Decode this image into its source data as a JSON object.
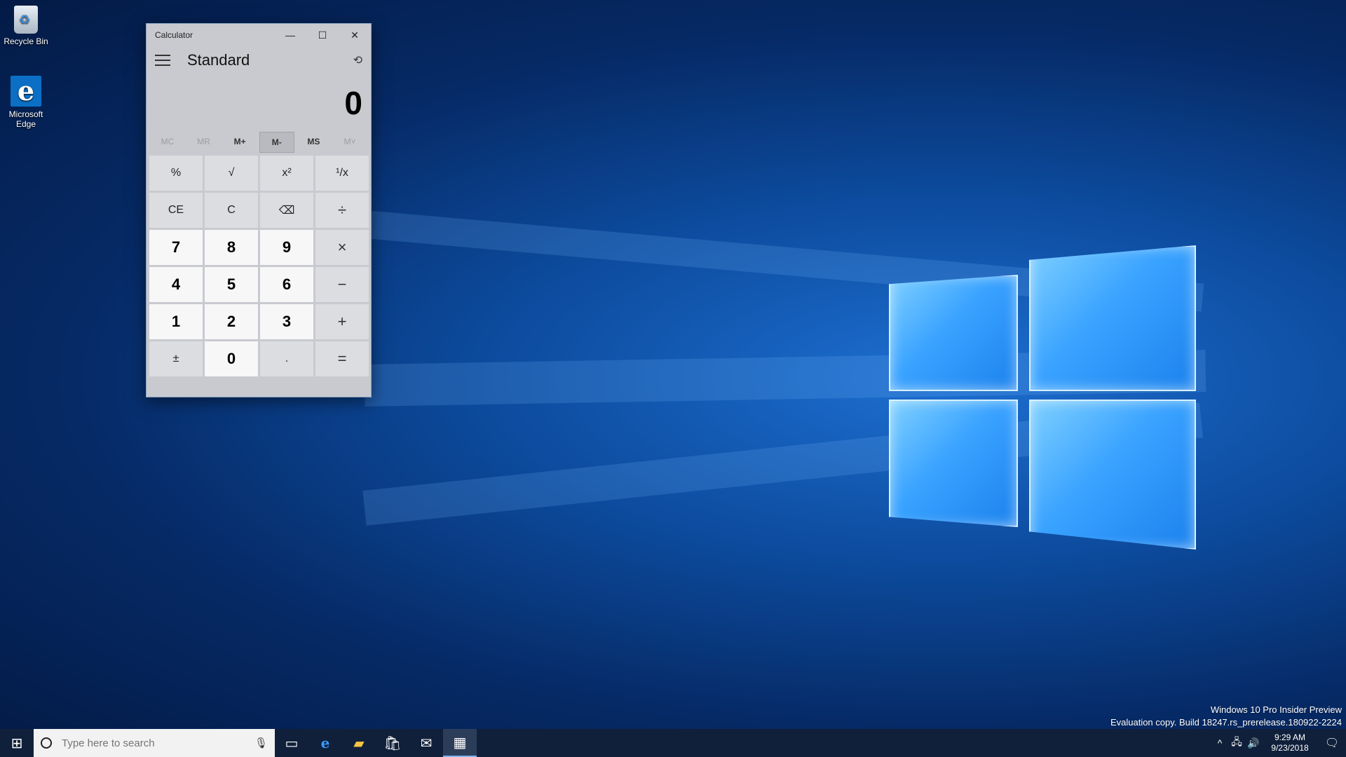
{
  "desktop": {
    "icons": [
      {
        "label": "Recycle Bin",
        "icon": "recycle-bin-icon"
      },
      {
        "label": "Microsoft\nEdge",
        "icon": "edge-icon"
      }
    ],
    "watermark_line1": "Windows 10 Pro Insider Preview",
    "watermark_line2": "Evaluation copy. Build 18247.rs_prerelease.180922-2224"
  },
  "calculator": {
    "window_title": "Calculator",
    "mode": "Standard",
    "display": "0",
    "memory": [
      "MC",
      "MR",
      "M+",
      "M-",
      "MS",
      "M˅"
    ],
    "keys": [
      {
        "label": "%",
        "type": "fn"
      },
      {
        "label": "√",
        "type": "fn"
      },
      {
        "label": "x²",
        "type": "fn"
      },
      {
        "label": "¹/x",
        "type": "fn"
      },
      {
        "label": "CE",
        "type": "fn"
      },
      {
        "label": "C",
        "type": "fn"
      },
      {
        "label": "⌫",
        "type": "fn"
      },
      {
        "label": "÷",
        "type": "op"
      },
      {
        "label": "7",
        "type": "num"
      },
      {
        "label": "8",
        "type": "num"
      },
      {
        "label": "9",
        "type": "num"
      },
      {
        "label": "×",
        "type": "op"
      },
      {
        "label": "4",
        "type": "num"
      },
      {
        "label": "5",
        "type": "num"
      },
      {
        "label": "6",
        "type": "num"
      },
      {
        "label": "−",
        "type": "op"
      },
      {
        "label": "1",
        "type": "num"
      },
      {
        "label": "2",
        "type": "num"
      },
      {
        "label": "3",
        "type": "num"
      },
      {
        "label": "+",
        "type": "op"
      },
      {
        "label": "±",
        "type": "fn"
      },
      {
        "label": "0",
        "type": "num"
      },
      {
        "label": ".",
        "type": "fn"
      },
      {
        "label": "=",
        "type": "op"
      }
    ]
  },
  "taskbar": {
    "search_placeholder": "Type here to search",
    "time": "9:29 AM",
    "date": "9/23/2018"
  },
  "colors": {
    "calc_bg": "#c8cacf",
    "taskbar_bg": "#10203a",
    "accent": "#1b82ee"
  }
}
